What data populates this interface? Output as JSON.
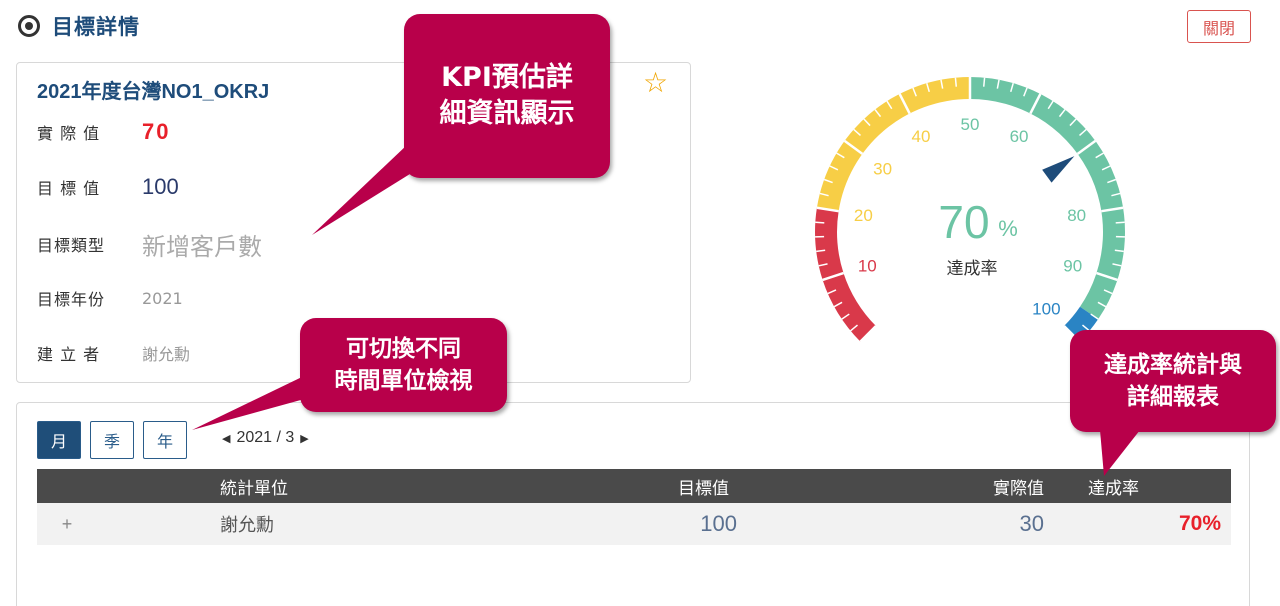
{
  "header": {
    "title": "目標詳情",
    "close_label": "關閉"
  },
  "kpi": {
    "title": "2021年度台灣NO1_OKRJ",
    "fields": [
      {
        "label": "實 際 值",
        "value": "70"
      },
      {
        "label": "目 標 值",
        "value": "100"
      },
      {
        "label": "目標類型",
        "value": "新增客戶數"
      },
      {
        "label": "目標年份",
        "value": "2021"
      },
      {
        "label": "建 立 者",
        "value": "謝允勳"
      }
    ]
  },
  "gauge": {
    "value": 70,
    "value_text": "70",
    "unit": "%",
    "label": "達成率",
    "min": 0,
    "max": 100,
    "ticks": [
      "10",
      "20",
      "30",
      "40",
      "50",
      "60",
      "80",
      "90",
      "100"
    ],
    "colors": {
      "red": "#d9394a",
      "yellow": "#f7ce46",
      "green": "#6cc4a4",
      "blue": "#2a84c4",
      "needle": "#1e4c7a"
    }
  },
  "report": {
    "periods": [
      "月",
      "季",
      "年"
    ],
    "active_period": "月",
    "date": "2021 / 3",
    "columns": [
      "統計單位",
      "目標值",
      "實際值",
      "達成率"
    ],
    "rows": [
      {
        "expand": "+",
        "unit": "謝允勳",
        "target": "100",
        "actual": "30",
        "rate": "70%"
      }
    ]
  },
  "callouts": {
    "kpi": [
      "KPI預估詳",
      "細資訊顯示"
    ],
    "period": [
      "可切換不同",
      "時間單位檢視"
    ],
    "stats": [
      "達成率統計與",
      "詳細報表"
    ]
  }
}
